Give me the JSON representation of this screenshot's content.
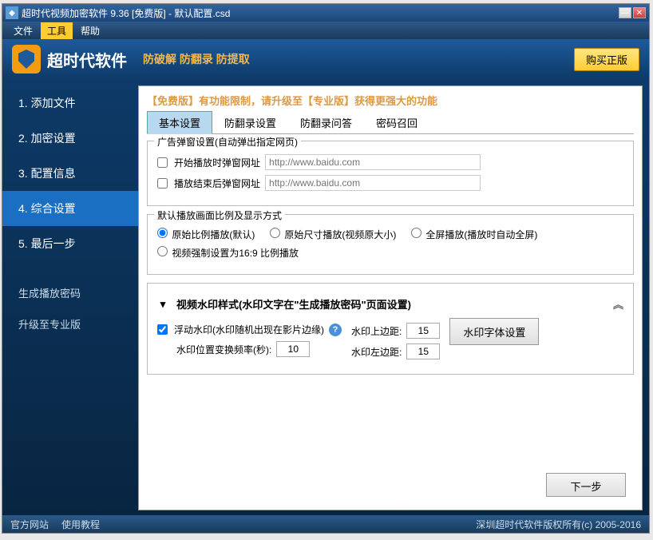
{
  "title": "超时代视频加密软件 9.36 [免费版] - 默认配置.csd",
  "menu": {
    "file": "文件",
    "tools": "工具",
    "help": "帮助"
  },
  "banner": {
    "title": "超时代软件",
    "subtitle": "防破解 防翻录 防提取",
    "buy": "购买正版"
  },
  "sidebar": {
    "s1": "1. 添加文件",
    "s2": "2. 加密设置",
    "s3": "3. 配置信息",
    "s4": "4. 综合设置",
    "s5": "5. 最后一步",
    "gen": "生成播放密码",
    "upgrade": "升级至专业版"
  },
  "notice": "【免费版】有功能限制，请升级至【专业版】获得更强大的功能",
  "tabs": {
    "t1": "基本设置",
    "t2": "防翻录设置",
    "t3": "防翻录问答",
    "t4": "密码召回"
  },
  "group1": {
    "title": "广告弹窗设置(自动弹出指定网页)",
    "cb1": "开始播放时弹窗网址",
    "cb2": "播放结束后弹窗网址",
    "ph": "http://www.baidu.com"
  },
  "group2": {
    "title": "默认播放画面比例及显示方式",
    "r1": "原始比例播放(默认)",
    "r2": "原始尺寸播放(视频原大小)",
    "r3": "全屏播放(播放时自动全屏)",
    "r4": "视频强制设置为16:9 比例播放"
  },
  "group3": {
    "title": "视频水印样式(水印文字在\"生成播放密码\"页面设置)",
    "cb": "浮动水印(水印随机出现在影片边缘)",
    "freq_label": "水印位置变换频率(秒):",
    "freq": "10",
    "top_label": "水印上边距:",
    "top": "15",
    "left_label": "水印左边距:",
    "left": "15",
    "font_btn": "水印字体设置"
  },
  "next": "下一步",
  "footer": {
    "site": "官方网站",
    "tutorial": "使用教程",
    "copy": "深圳超时代软件版权所有(c) 2005-2016"
  }
}
